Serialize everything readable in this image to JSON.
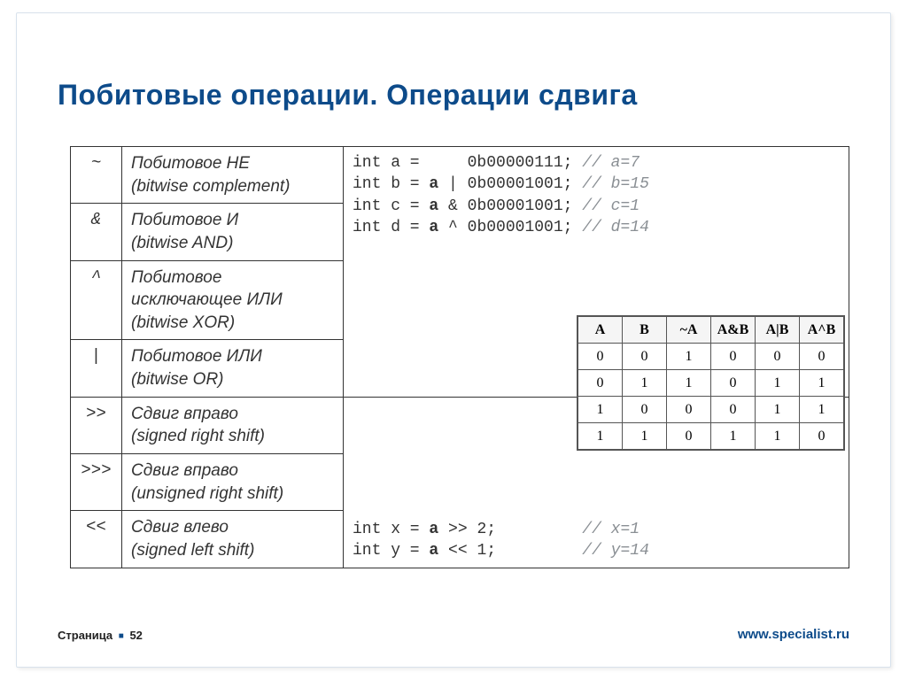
{
  "title": "Побитовые операции. Операции сдвига",
  "ops": [
    {
      "sym": "~",
      "desc": "Побитовое НЕ\n(bitwise complement)"
    },
    {
      "sym": "&",
      "desc": "Побитовое И\n(bitwise AND)"
    },
    {
      "sym": "^",
      "desc": "Побитовое\nисключающее ИЛИ\n(bitwise XOR)"
    },
    {
      "sym": "|",
      "desc": "Побитовое ИЛИ\n(bitwise OR)"
    },
    {
      "sym": ">>",
      "desc": "Сдвиг вправо\n(signed right shift)"
    },
    {
      "sym": ">>>",
      "desc": "Сдвиг вправо\n(unsigned right shift)"
    },
    {
      "sym": "<<",
      "desc": "Сдвиг влево\n(signed left shift)"
    }
  ],
  "code_top": {
    "l1a": "int a =     0b00000111; ",
    "l1c": "// a=7",
    "l2a": "int b = ",
    "l2b": "a",
    "l2c": " | 0b00001001; ",
    "l2d": "// b=15",
    "l3a": "int c = ",
    "l3b": "a",
    "l3c": " & 0b00001001; ",
    "l3d": "// c=1",
    "l4a": "int d = ",
    "l4b": "a",
    "l4c": " ^ 0b00001001; ",
    "l4d": "// d=14"
  },
  "code_bottom": {
    "l1a": "int x = ",
    "l1b": "a",
    "l1c": " >> 2;         ",
    "l1d": "// x=1",
    "l2a": "int y = ",
    "l2b": "a",
    "l2c": " << 1;         ",
    "l2d": "// y=14"
  },
  "truth": {
    "headers": [
      "A",
      "B",
      "~A",
      "A&B",
      "A|B",
      "A^B"
    ],
    "rows": [
      [
        "0",
        "0",
        "1",
        "0",
        "0",
        "0"
      ],
      [
        "0",
        "1",
        "1",
        "0",
        "1",
        "1"
      ],
      [
        "1",
        "0",
        "0",
        "0",
        "1",
        "1"
      ],
      [
        "1",
        "1",
        "0",
        "1",
        "1",
        "0"
      ]
    ]
  },
  "footer": {
    "page_label": "Страница",
    "page_num": "52",
    "url": "www.specialist.ru"
  }
}
